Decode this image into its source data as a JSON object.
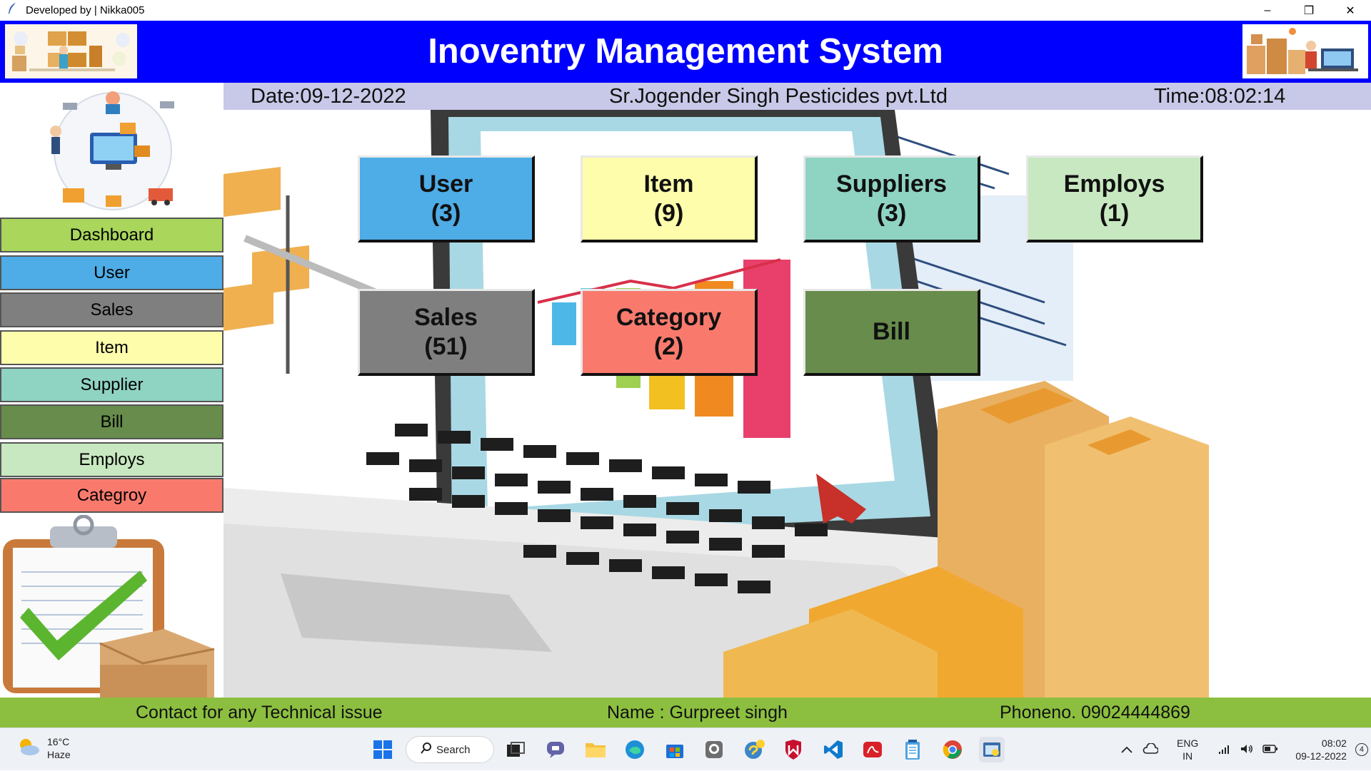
{
  "window": {
    "title": "Developed by | Nikka005",
    "controls": {
      "minimize": "–",
      "restore": "❐",
      "close": "✕"
    }
  },
  "header": {
    "title": "Inoventry Management System"
  },
  "infobar": {
    "date": "Date:09-12-2022",
    "company": "Sr.Jogender Singh Pesticides pvt.Ltd",
    "time": "Time:08:02:14"
  },
  "sidebar": {
    "items": [
      {
        "label": "Dashboard",
        "color": "#a9d65b"
      },
      {
        "label": "User",
        "color": "#4eace6"
      },
      {
        "label": "Sales",
        "color": "#7f7f7f"
      },
      {
        "label": "Item",
        "color": "#fdfdab"
      },
      {
        "label": "Supplier",
        "color": "#8fd3c3"
      },
      {
        "label": "Bill",
        "color": "#678c4b"
      },
      {
        "label": "Employs",
        "color": "#c7e8c0"
      },
      {
        "label": "Categroy",
        "color": "#f97a6d"
      }
    ]
  },
  "tiles": [
    {
      "name": "User",
      "count": "(3)",
      "color": "#4eace6"
    },
    {
      "name": "Item",
      "count": "(9)",
      "color": "#fdfdab"
    },
    {
      "name": "Suppliers",
      "count": "(3)",
      "color": "#8fd3c3"
    },
    {
      "name": "Employs",
      "count": "(1)",
      "color": "#c7e8c0"
    },
    {
      "name": "Sales",
      "count": "(51)",
      "color": "#7f7f7f"
    },
    {
      "name": "Category",
      "count": "(2)",
      "color": "#f97a6d"
    },
    {
      "name": "Bill",
      "count": "",
      "color": "#678c4b"
    }
  ],
  "footer": {
    "contact": "Contact for any Technical issue",
    "name": "Name : Gurpreet singh",
    "phone": "Phoneno. 09024444869"
  },
  "taskbar": {
    "weather_temp": "16°C",
    "weather_desc": "Haze",
    "search_label": "Search",
    "lang_top": "ENG",
    "lang_bottom": "IN",
    "clock_time": "08:02",
    "clock_date": "09-12-2022",
    "notification_count": "4"
  },
  "colors": {
    "header_bg": "#0000ff",
    "infobar_bg": "#c8c8e8",
    "footer_bg": "#8cbf3f"
  }
}
